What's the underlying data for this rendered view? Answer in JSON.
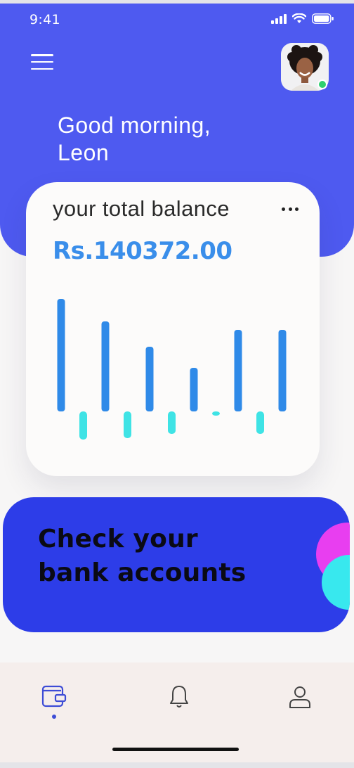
{
  "status_bar": {
    "time": "9:41"
  },
  "greeting": {
    "line1": "Good morning,",
    "line2": "Leon"
  },
  "balance_card": {
    "label": "your total balance",
    "amount": "Rs.140372.00"
  },
  "chart_data": {
    "type": "bar",
    "series": [
      {
        "values": [
          160,
          128,
          92,
          62,
          116,
          116
        ],
        "color": "#2f8ae8"
      },
      {
        "values": [
          -40,
          -38,
          -32,
          -6,
          -32
        ],
        "color": "#3fe3e5"
      }
    ]
  },
  "promo": {
    "line1": "Check your",
    "line2": "bank accounts"
  },
  "nav": {
    "items": [
      {
        "icon": "wallet-icon",
        "active": true
      },
      {
        "icon": "bell-icon",
        "active": false
      },
      {
        "icon": "user-icon",
        "active": false
      }
    ]
  },
  "colors": {
    "accent": "#4e5af0",
    "promo": "#2d3de8",
    "bar_up": "#2f8ae8",
    "bar_down": "#3fe3e5",
    "amount": "#3a8eea"
  }
}
